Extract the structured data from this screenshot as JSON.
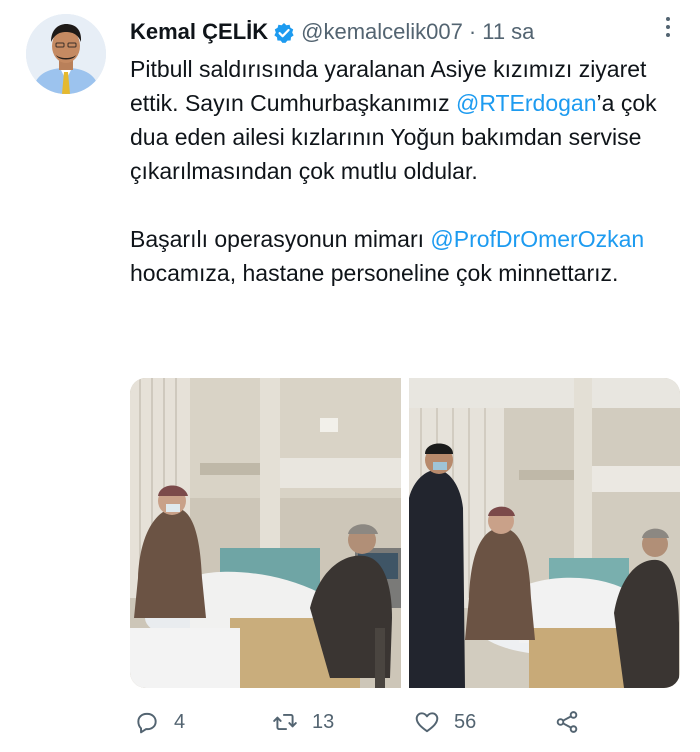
{
  "author": {
    "name": "Kemal ÇELİK",
    "handle": "@kemalcelik007",
    "time": "11 sa",
    "separator": "·"
  },
  "tweet": {
    "para1_before": "Pitbull saldırısında yaralanan Asiye kızımızı ziyaret ettik. Sayın Cumhurbaşkanımız ",
    "mention1": "@RTErdogan",
    "para1_after": "’a çok dua eden ailesi kızlarının Yoğun bakımdan servise çıkarılmasından çok mutlu oldular.",
    "para2_before": "Başarılı operasyonun mimarı ",
    "mention2": "@ProfDrOmerOzkan",
    "para2_after": " hocamıza, hastane personeline  çok minnettarız."
  },
  "actions": {
    "reply_count": "4",
    "retweet_count": "13",
    "like_count": "56"
  },
  "icons": {
    "verified": "verified-badge-icon",
    "more": "more-dots-icon",
    "reply": "reply-icon",
    "retweet": "retweet-icon",
    "like": "heart-icon",
    "share": "share-icon"
  },
  "colors": {
    "link": "#1d9bf0",
    "muted": "#536471",
    "text": "#0f1419"
  }
}
